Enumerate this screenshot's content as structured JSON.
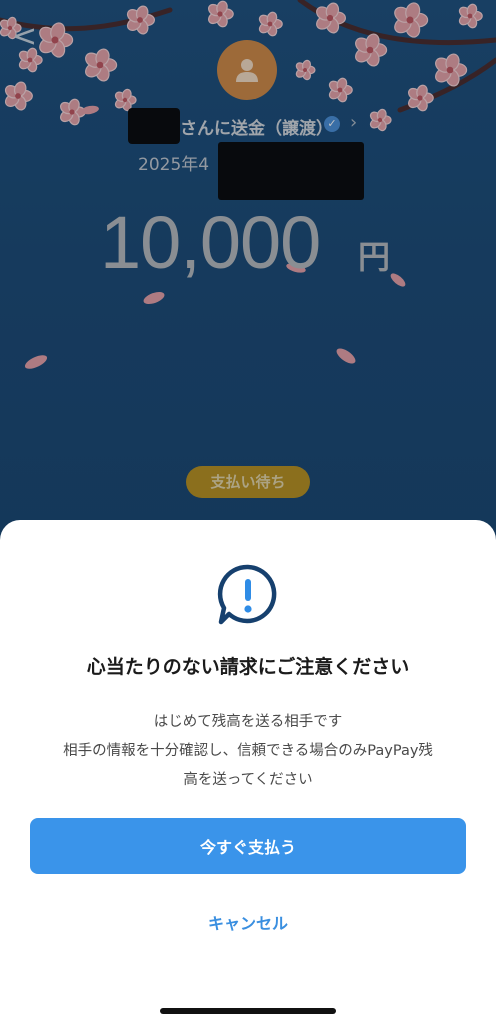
{
  "header": {
    "back_glyph": "<",
    "back_icon": "chevron-left-icon"
  },
  "transfer": {
    "recipient_suffix": "さんに送金（譲渡）",
    "date_prefix": "2025年4",
    "amount": "10,000",
    "currency_unit": "円",
    "status": "支払い待ち"
  },
  "dialog": {
    "title": "心当たりのない請求にご注意ください",
    "message_lines": [
      "はじめて残高を送る相手です",
      "相手の情報を十分確認し、信頼できる場合のみPayPay残",
      "高を送ってください"
    ],
    "primary_button": "今すぐ支払う",
    "cancel_button": "キャンセル"
  },
  "colors": {
    "background": "#1c4a74",
    "avatar": "#d18a45",
    "status_badge": "#b8901f",
    "primary_button": "#3a94ea",
    "cancel_text": "#3a8fe0",
    "alert_icon": "#16406e"
  }
}
